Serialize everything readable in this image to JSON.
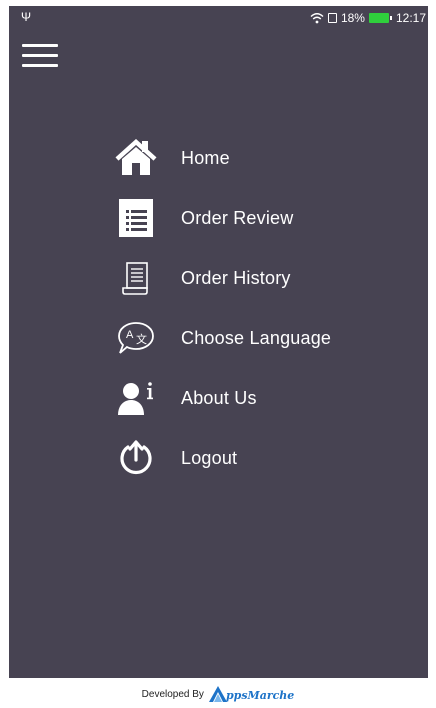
{
  "status_bar": {
    "usb_icon": "usb-icon",
    "battery_percent": "18%",
    "time": "12:17"
  },
  "menu": {
    "items": [
      {
        "label": "Home",
        "icon": "home-icon"
      },
      {
        "label": "Order Review",
        "icon": "order-review-icon"
      },
      {
        "label": "Order History",
        "icon": "order-history-icon"
      },
      {
        "label": "Choose Language",
        "icon": "language-icon"
      },
      {
        "label": "About Us",
        "icon": "about-us-icon"
      },
      {
        "label": "Logout",
        "icon": "logout-icon"
      }
    ]
  },
  "footer": {
    "developed_by": "Developed By",
    "brand_letter": "A",
    "brand_rest": "ppsMarche"
  },
  "colors": {
    "background": "#474352",
    "battery": "#2fcf3c",
    "brand": "#1d73c8"
  }
}
